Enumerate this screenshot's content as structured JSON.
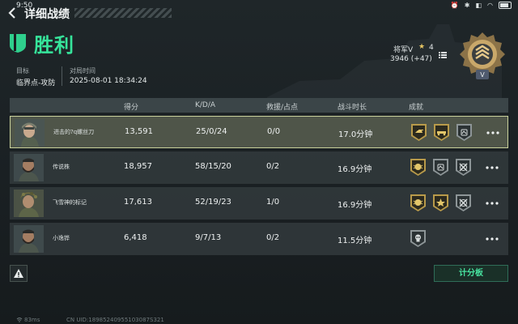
{
  "status_bar": {
    "time": "9:50",
    "battery_level": 0.8
  },
  "header": {
    "title": "详细战绩"
  },
  "result": {
    "title": "胜利"
  },
  "meta": {
    "target_label": "目标",
    "target_value": "临界点-攻防",
    "time_label": "对局时间",
    "time_value": "2025-08-01 18:34:24"
  },
  "rank": {
    "name": "将军V",
    "level": "4",
    "points": "3946 (+47)",
    "badge_text": "V"
  },
  "columns": {
    "score": "得分",
    "kda": "K/D/A",
    "rescue": "救援/占点",
    "duration": "战斗时长",
    "achievements": "成就"
  },
  "players": [
    {
      "name": "进击的?q螺丝刀",
      "score": "13,591",
      "kda": "25/0/24",
      "rescue": "0/0",
      "duration": "17.0分钟",
      "badges": [
        "gold-tank-badge",
        "gold-vehicle-badge",
        "silver-medal-badge"
      ],
      "avatar": "soldier-helmet-avatar",
      "selected": true
    },
    {
      "name": "传说株",
      "score": "18,957",
      "kda": "58/15/20",
      "rescue": "0/2",
      "duration": "16.9分钟",
      "badges": [
        "gold-crest-badge",
        "silver-medal-badge",
        "silver-crossed-badge"
      ],
      "avatar": "soldier-bearded-avatar",
      "selected": false
    },
    {
      "name": "飞雪神的标记",
      "score": "17,613",
      "kda": "52/19/23",
      "rescue": "1/0",
      "duration": "16.9分钟",
      "badges": [
        "gold-crest-badge",
        "gold-star-badge",
        "silver-crossed-badge"
      ],
      "avatar": "soldier-camo-avatar",
      "selected": false
    },
    {
      "name": "小逸铧",
      "score": "6,418",
      "kda": "9/7/13",
      "rescue": "0/2",
      "duration": "11.5分钟",
      "badges": [
        "silver-skull-badge"
      ],
      "avatar": "soldier-bearded-avatar",
      "selected": false
    }
  ],
  "footer": {
    "scoreboard_label": "计分板",
    "ping": "83ms",
    "uid": "CN UID:18985240955103087S321"
  }
}
